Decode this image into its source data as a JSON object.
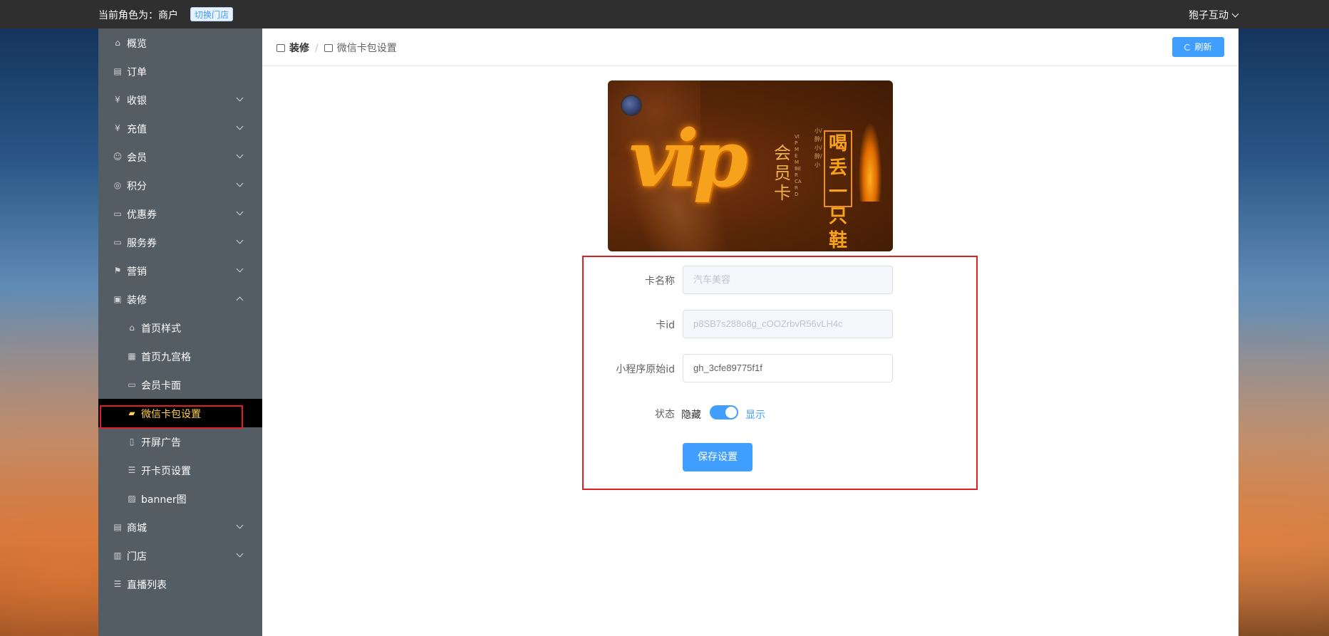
{
  "topbar": {
    "role_text": "当前角色为：商户",
    "switch_store": "切换门店",
    "user": "狍子互动"
  },
  "sidebar": {
    "items": [
      {
        "label": "概览",
        "icon": "home-icon"
      },
      {
        "label": "订单",
        "icon": "order-icon"
      },
      {
        "label": "收银",
        "icon": "cashier-icon"
      },
      {
        "label": "充值",
        "icon": "recharge-icon"
      },
      {
        "label": "会员",
        "icon": "member-icon"
      },
      {
        "label": "积分",
        "icon": "points-icon"
      },
      {
        "label": "优惠券",
        "icon": "coupon-icon"
      },
      {
        "label": "服务券",
        "icon": "service-coupon-icon"
      },
      {
        "label": "营销",
        "icon": "marketing-icon"
      },
      {
        "label": "装修",
        "icon": "decoration-icon"
      },
      {
        "label": "首页样式",
        "icon": "home-icon"
      },
      {
        "label": "首页九宫格",
        "icon": "grid-icon"
      },
      {
        "label": "会员卡面",
        "icon": "card-icon"
      },
      {
        "label": "微信卡包设置",
        "icon": "wallet-icon"
      },
      {
        "label": "开屏广告",
        "icon": "phone-icon"
      },
      {
        "label": "开卡页设置",
        "icon": "form-icon"
      },
      {
        "label": "banner图",
        "icon": "image-icon"
      },
      {
        "label": "商城",
        "icon": "mall-icon"
      },
      {
        "label": "门店",
        "icon": "store-icon"
      },
      {
        "label": "直播列表",
        "icon": "list-icon"
      }
    ]
  },
  "breadcrumb": {
    "parent": "装修",
    "current": "微信卡包设置"
  },
  "refresh_label": "刷新",
  "card": {
    "vip": "vip",
    "member_card": "会员卡",
    "brand": "喝丢一只鞋",
    "slogan": "小/醉/小/醉/小",
    "small_text": "VIP MEMBER CARD"
  },
  "form": {
    "card_name_label": "卡名称",
    "card_name_value": "汽车美容",
    "card_id_label": "卡id",
    "card_id_value": "p8SB7s288o8g_cOOZrbvR56vLH4c",
    "mini_id_label": "小程序原始id",
    "mini_id_value": "gh_3cfe89775f1f",
    "status_label": "状态",
    "status_off": "隐藏",
    "status_on": "显示",
    "status_enabled": true,
    "save_label": "保存设置"
  },
  "colors": {
    "primary": "#409eff",
    "sidebar_bg": "#545c64",
    "active_text": "#ffd04b",
    "highlight": "#e02020"
  }
}
